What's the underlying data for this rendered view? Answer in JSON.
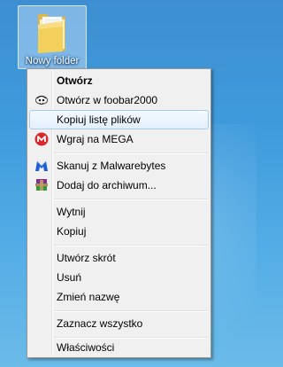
{
  "desktop": {
    "folder_label": "Nowy folder",
    "folder_icon": "folder-icon"
  },
  "context_menu": {
    "items": [
      {
        "label": "Otwórz",
        "bold": true
      },
      {
        "label": "Otwórz w foobar2000",
        "icon": "foobar-icon"
      },
      {
        "label": "Kopiuj listę plików",
        "highlighted": true
      },
      {
        "label": "Wgraj na MEGA",
        "icon": "mega-icon"
      },
      {
        "label": "Skanuj z Malwarebytes",
        "icon": "malwarebytes-icon"
      },
      {
        "label": "Dodaj do archiwum...",
        "icon": "winrar-icon"
      },
      {
        "label": "Wytnij"
      },
      {
        "label": "Kopiuj"
      },
      {
        "label": "Utwórz skrót"
      },
      {
        "label": "Usuń"
      },
      {
        "label": "Zmień nazwę"
      },
      {
        "label": "Zaznacz wszystko"
      },
      {
        "label": "Właściwości"
      }
    ]
  },
  "colors": {
    "mega_red": "#d9272e",
    "malwarebytes_blue": "#1f5fd6",
    "highlight_border": "#a8cbf1"
  }
}
